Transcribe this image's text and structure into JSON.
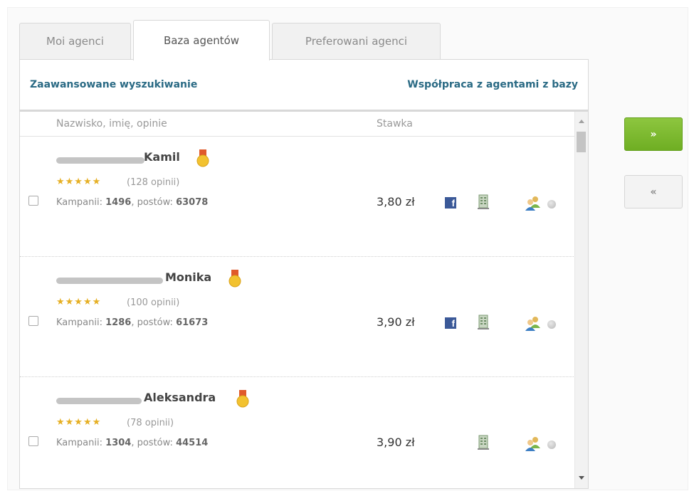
{
  "tabs": [
    {
      "label": "Moi agenci"
    },
    {
      "label": "Baza agentów"
    },
    {
      "label": "Preferowani agenci"
    }
  ],
  "links": {
    "advanced_search": "Zaawansowane wyszukiwanie",
    "cooperation": "Współpraca z agentami z bazy"
  },
  "columns": {
    "name": "Nazwisko, imię, opinie",
    "rate": "Stawka"
  },
  "labels": {
    "campaigns": "Kampanii:",
    "posts": "postów:"
  },
  "agents": [
    {
      "name": "Kamil",
      "stars": "★★★★★",
      "opinions": "(128 opinii)",
      "campaigns": "1496",
      "posts": "63078",
      "rate": "3,80 zł",
      "facebook": "f"
    },
    {
      "name": "Monika",
      "stars": "★★★★★",
      "opinions": "(100 opinii)",
      "campaigns": "1286",
      "posts": "61673",
      "rate": "3,90 zł",
      "facebook": "f"
    },
    {
      "name": "Aleksandra",
      "stars": "★★★★★",
      "opinions": "(78 opinii)",
      "campaigns": "1304",
      "posts": "44514",
      "rate": "3,90 zł",
      "facebook": ""
    }
  ],
  "buttons": {
    "forward": "»",
    "back": "«"
  },
  "colors": {
    "link": "#2a6a84",
    "star": "#e6b025",
    "forward_button": "#7cba2f",
    "facebook": "#3b5998"
  }
}
